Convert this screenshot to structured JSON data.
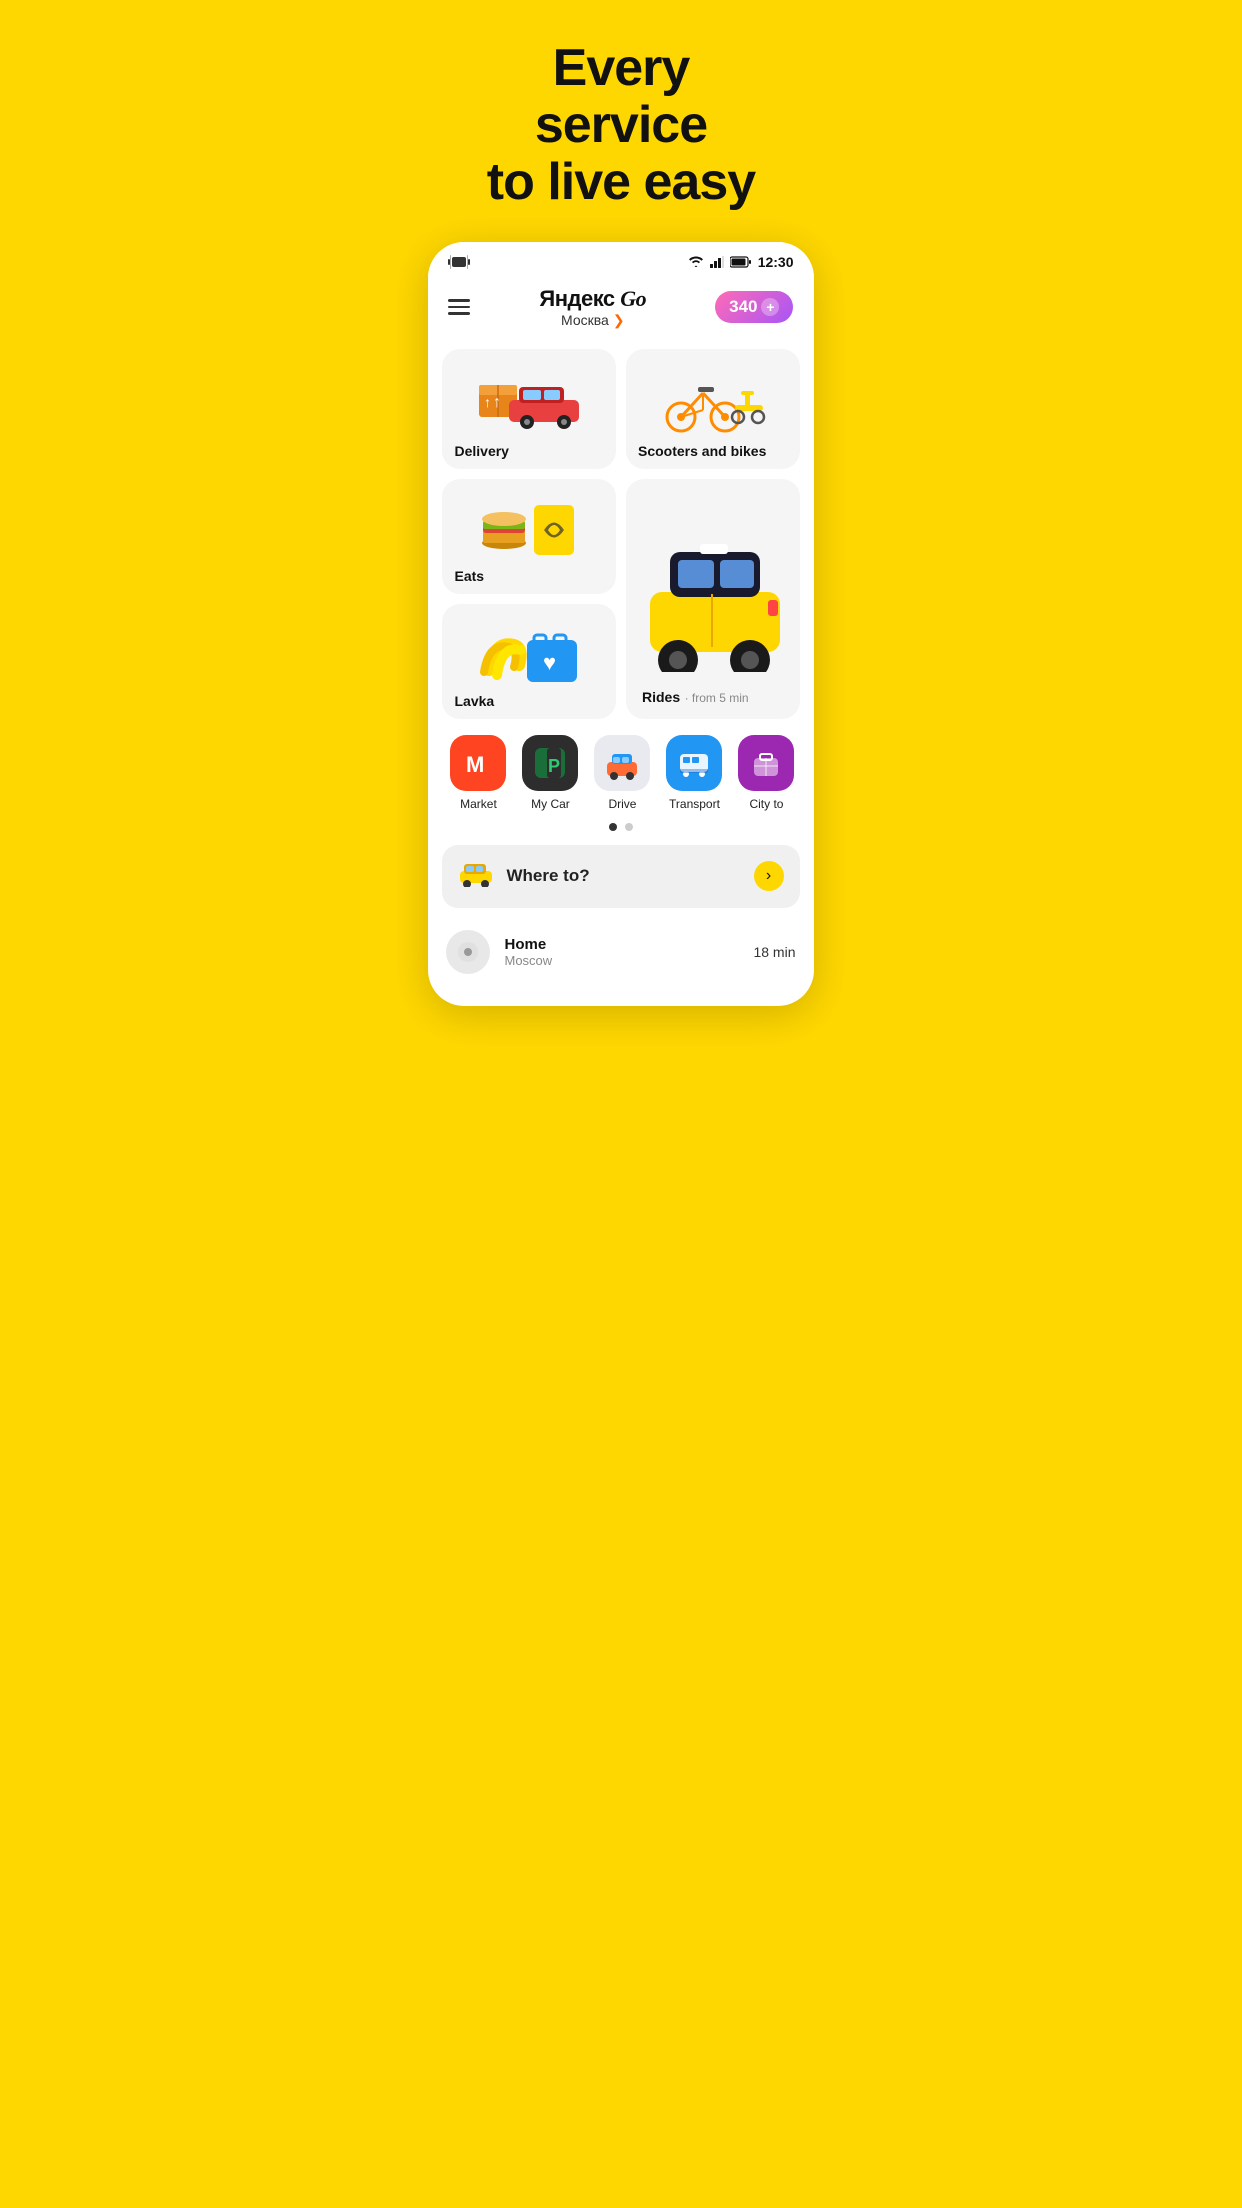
{
  "hero": {
    "line1": "Every",
    "line2": "service",
    "line3": "to live easy"
  },
  "statusBar": {
    "time": "12:30",
    "vibrate": "📳"
  },
  "header": {
    "brandName": "Яндекс",
    "brandGo": "Go",
    "city": "Москва",
    "points": "340"
  },
  "services": {
    "delivery": {
      "label": "Delivery"
    },
    "scooters": {
      "label": "Scooters and bikes"
    },
    "eats": {
      "label": "Eats"
    },
    "lavka": {
      "label": "Lavka"
    },
    "rides": {
      "label": "Rides",
      "sublabel": "· from 5 min"
    }
  },
  "smallIcons": [
    {
      "id": "market",
      "label": "Market",
      "emoji": "🛒",
      "bg": "#ff4422"
    },
    {
      "id": "mycar",
      "label": "My Car",
      "emoji": "🅿️",
      "bg": "#2d2d2d"
    },
    {
      "id": "drive",
      "label": "Drive",
      "emoji": "🚗",
      "bg": "#e8eaf0"
    },
    {
      "id": "transport",
      "label": "Transport",
      "emoji": "🚌",
      "bg": "#2196f3"
    },
    {
      "id": "cityto",
      "label": "City to",
      "emoji": "🧳",
      "bg": "#9c27b0"
    }
  ],
  "dots": [
    {
      "active": true
    },
    {
      "active": false
    }
  ],
  "whereToBar": {
    "placeholder": "Where to?",
    "arrowSymbol": "›"
  },
  "savedPlace": {
    "name": "Home",
    "sub": "Moscow",
    "time": "18 min"
  }
}
